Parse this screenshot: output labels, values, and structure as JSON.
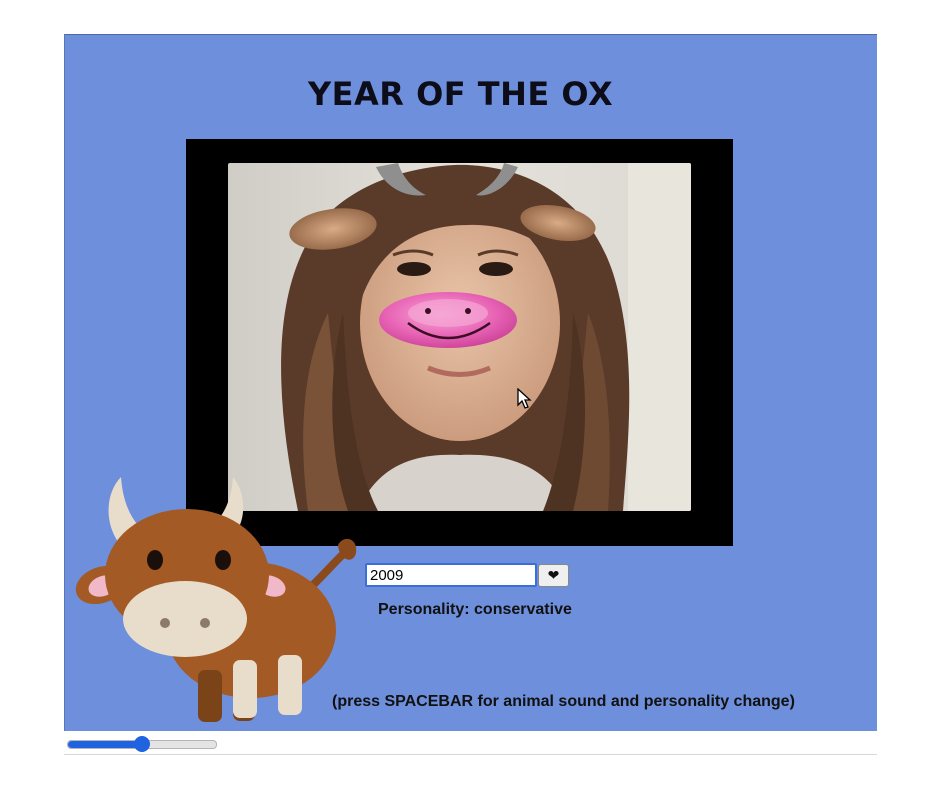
{
  "app": {
    "title": "YEAR OF THE OX"
  },
  "colors": {
    "background": "#6e8fdc",
    "frame": "#000000",
    "accent": "#1f63e0"
  },
  "controls": {
    "year_input_value": "2009",
    "heart_button_label": "❤"
  },
  "personality": {
    "text": "Personality: conservative"
  },
  "hint": {
    "text": "(press SPACEBAR for animal sound and personality change)"
  },
  "slider": {
    "value_fraction": 0.5
  },
  "icons": {
    "ox": "ox-cartoon-icon",
    "cursor": "mouse-pointer-icon",
    "heart": "heart-icon"
  }
}
